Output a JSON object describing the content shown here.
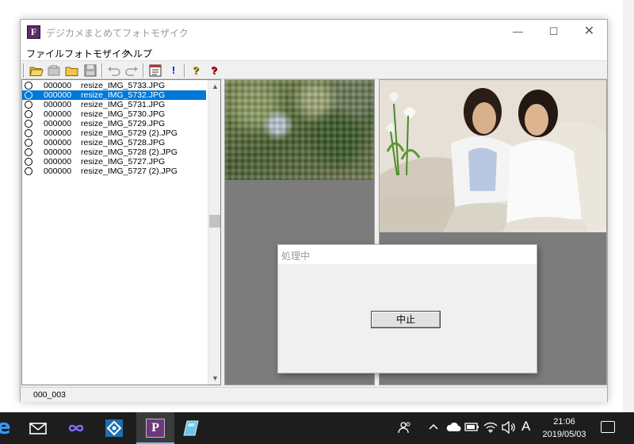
{
  "window": {
    "title": "デジカメまとめてフォトモザイク",
    "app_icon_letter": "F",
    "minimize_glyph": "—",
    "maximize_glyph": "☐",
    "close_glyph": "✕"
  },
  "menu": {
    "items": [
      {
        "label": "ファイル"
      },
      {
        "label": "フォトモザイク"
      },
      {
        "label": "ヘルプ"
      }
    ]
  },
  "toolbar": {
    "icons": [
      "open-folder-icon",
      "save-image-icon",
      "new-folder-icon",
      "save-disk-icon",
      "undo-icon",
      "redo-icon",
      "list-icon",
      "exclamation-icon",
      "help-icon",
      "context-help-icon"
    ]
  },
  "file_list": {
    "selected_index": 1,
    "items": [
      {
        "code": "000000",
        "name": "resize_IMG_5733.JPG"
      },
      {
        "code": "000000",
        "name": "resize_IMG_5732.JPG"
      },
      {
        "code": "000000",
        "name": "resize_IMG_5731.JPG"
      },
      {
        "code": "000000",
        "name": "resize_IMG_5730.JPG"
      },
      {
        "code": "000000",
        "name": "resize_IMG_5729.JPG"
      },
      {
        "code": "000000",
        "name": "resize_IMG_5729 (2).JPG"
      },
      {
        "code": "000000",
        "name": "resize_IMG_5728.JPG"
      },
      {
        "code": "000000",
        "name": "resize_IMG_5728 (2).JPG"
      },
      {
        "code": "000000",
        "name": "resize_IMG_5727.JPG"
      },
      {
        "code": "000000",
        "name": "resize_IMG_5727 (2).JPG"
      }
    ]
  },
  "status": {
    "text": "000_003"
  },
  "dialog": {
    "title": "処理中",
    "stop_button": "中止"
  },
  "taskbar": {
    "time": "21:06",
    "date": "2019/05/03",
    "ime": "A",
    "pinned_app_letter": "P"
  },
  "colors": {
    "selection": "#0078d7",
    "pane_bg": "#7c7c7c",
    "taskbar_bg": "#1d1d1d"
  }
}
